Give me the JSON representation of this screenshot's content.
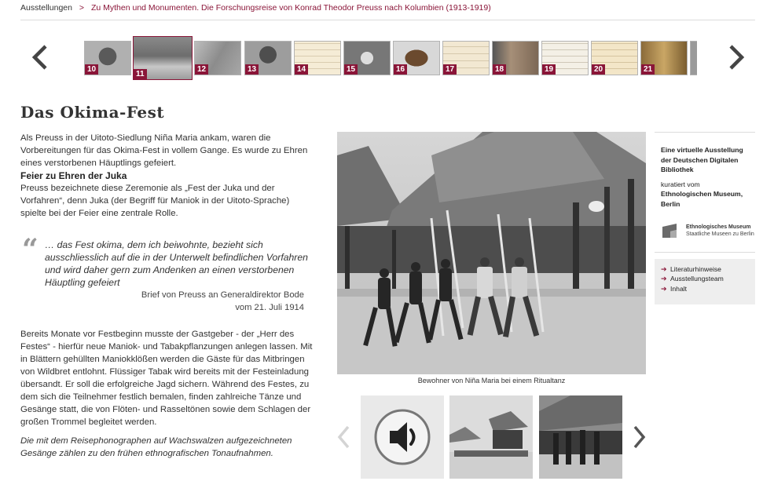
{
  "breadcrumb": {
    "root": "Ausstellungen",
    "separator": ">",
    "current": "Zu Mythen und Monumenten. Die Forschungsreise von Konrad Theodor Preuss nach Kolumbien (1913-1919)"
  },
  "thumbnails": [
    {
      "num": "10"
    },
    {
      "num": "11"
    },
    {
      "num": "12"
    },
    {
      "num": "13"
    },
    {
      "num": "14"
    },
    {
      "num": "15"
    },
    {
      "num": "16"
    },
    {
      "num": "17"
    },
    {
      "num": "18"
    },
    {
      "num": "19"
    },
    {
      "num": "20"
    },
    {
      "num": "21"
    }
  ],
  "active_thumbnail": "11",
  "page": {
    "title": "Das Okima-Fest"
  },
  "text": {
    "intro": "Als Preuss in der Uitoto-Siedlung Niña Maria ankam, waren die Vorbereitungen für das Okima-Fest in vollem Gange. Es wurde zu Ehren eines verstorbenen Häuptlings gefeiert.",
    "subheading": "Feier zu Ehren der Juka",
    "para1": "Preuss bezeichnete diese Zeremonie als „Fest der Juka und der Vorfahren“, denn Juka (der Begriff für Maniok in der Uitoto-Sprache) spielte bei der Feier eine zentrale Rolle.",
    "quote_mark": "“",
    "quote": "… das Fest okima, dem ich beiwohnte, bezieht sich ausschliesslich auf die in der Unterwelt befindlichen Vorfahren und wird daher gern zum Andenken an einen verstorbenen Häuptling gefeiert",
    "quote_source_1": "Brief von Preuss an Generaldirektor Bode",
    "quote_source_2": "vom 21. Juli 1914",
    "para2": "Bereits Monate vor Festbeginn musste der Gastgeber - der „Herr des Festes“ - hierfür neue Maniok- und Tabakpflanzungen anlegen lassen. Mit in Blättern gehüllten Maniokklößen werden die Gäste für das Mitbringen von Wildbret entlohnt. Flüssiger Tabak wird bereits mit der Festeinladung übersandt. Er soll die erfolgreiche Jagd sichern. Während des Festes, zu dem sich die Teilnehmer festlich bemalen, finden zahlreiche Tänze und Gesänge statt, die von Flöten- und Rasseltönen sowie dem Schlagen der großen Trommel begleitet werden.",
    "para3": "Die mit dem Reisephonographen auf Wachswalzen aufgezeichneten Gesänge zählen zu den frühen ethnografischen Tonaufnahmen."
  },
  "photo": {
    "caption": "Bewohner von Niña Maria bei einem Ritualtanz"
  },
  "sidebar": {
    "title": "Eine virtuelle Ausstellung der Deutschen Digitalen Bibliothek",
    "curated_by": "kuratiert vom",
    "museum_bold": "Ethnologischen Museum, Berlin",
    "logo_line1": "Ethnologisches Museum",
    "logo_line2": "Staatliche Museen zu Berlin",
    "links": [
      "Literaturhinweise",
      "Ausstellungsteam",
      "Inhalt"
    ]
  },
  "colors": {
    "accent": "#8a1538",
    "text": "#333333",
    "sidebar_bg": "#eeeeee"
  }
}
